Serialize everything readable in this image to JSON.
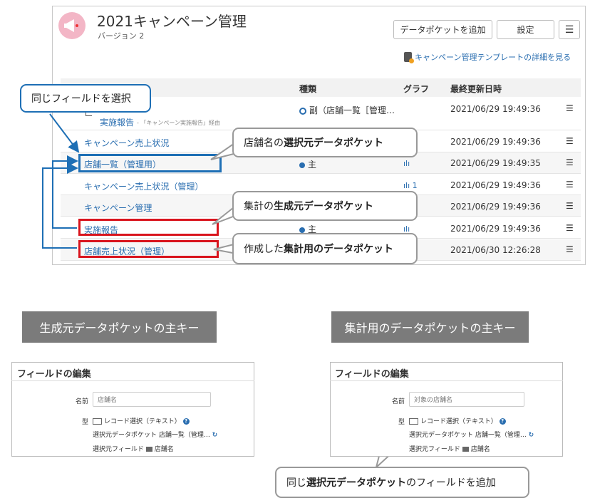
{
  "header": {
    "title": "2021キャンペーン管理",
    "version": "バージョン 2",
    "add_button": "データポケットを追加",
    "settings_button": "設定",
    "menu_glyph": "☰",
    "template_link": "キャンペーン管理テンプレートの詳細を見る"
  },
  "table": {
    "columns": {
      "kind": "種類",
      "graph": "グラフ",
      "updated": "最終更新日時"
    },
    "rows": [
      {
        "name": "実施報告",
        "note": "- 「キャンペーン実施報告」経由",
        "type": "副（店舗一覧［管理…",
        "graph": "",
        "updated": "2021/06/29 19:49:36"
      },
      {
        "name": "キャンペーン売上状況",
        "type": "",
        "graph": "",
        "updated": "2021/06/29 19:49:36"
      },
      {
        "name": "店舗一覧（管理用）",
        "type": "主",
        "graph": "ılı",
        "updated": "2021/06/29 19:49:35"
      },
      {
        "name": "キャンペーン売上状況（管理）",
        "type": "",
        "graph": "ılı 1",
        "updated": "2021/06/29 19:49:36"
      },
      {
        "name": "キャンペーン管理",
        "type": "",
        "graph": "",
        "updated": "2021/06/29 19:49:36"
      },
      {
        "name": "実施報告",
        "type": "主",
        "graph": "ılı",
        "updated": "2021/06/29 19:49:36"
      },
      {
        "name": "店舗売上状況（管理）",
        "type": "",
        "graph": "",
        "updated": "2021/06/30 12:26:28"
      }
    ]
  },
  "callouts": {
    "same_field": "同じフィールドを選択",
    "source_store_pre": "店舗名の",
    "source_store_bold": "選択元データポケット",
    "generator_pre": "集計の",
    "generator_bold": "生成元データポケット",
    "created_pre": "作成した",
    "created_bold": "集計用のデータポケット",
    "add_field_pre": "同じ",
    "add_field_bold": "選択元データポケット",
    "add_field_post": "のフィールドを追加"
  },
  "captions": {
    "left": "生成元データポケットの主キー",
    "right": "集計用のデータポケットの主キー"
  },
  "dialog_left": {
    "title": "フィールドの編集",
    "name_label": "名前",
    "name_value": "店舗名",
    "type_label": "型",
    "type_value": "レコード選択（テキスト）",
    "source_pocket": "選択元データポケット 店舗一覧（管理…",
    "source_field": "選択元フィールド",
    "source_field_value": "店舗名"
  },
  "dialog_right": {
    "title": "フィールドの編集",
    "name_label": "名前",
    "name_value": "対象の店舗名",
    "type_label": "型",
    "type_value": "レコード選択（テキスト）",
    "source_pocket": "選択元データポケット 店舗一覧（管理…",
    "source_field": "選択元フィールド",
    "source_field_value": "店舗名"
  },
  "icons": {
    "app": "megaphone-icon",
    "template": "document-icon",
    "row_menu": "hamburger-icon",
    "help": "question-icon",
    "refresh": "refresh-icon"
  },
  "colors": {
    "accent_blue": "#1e6fb5",
    "highlight_red": "#d9141d",
    "caption_gray": "#7b7b7b"
  }
}
